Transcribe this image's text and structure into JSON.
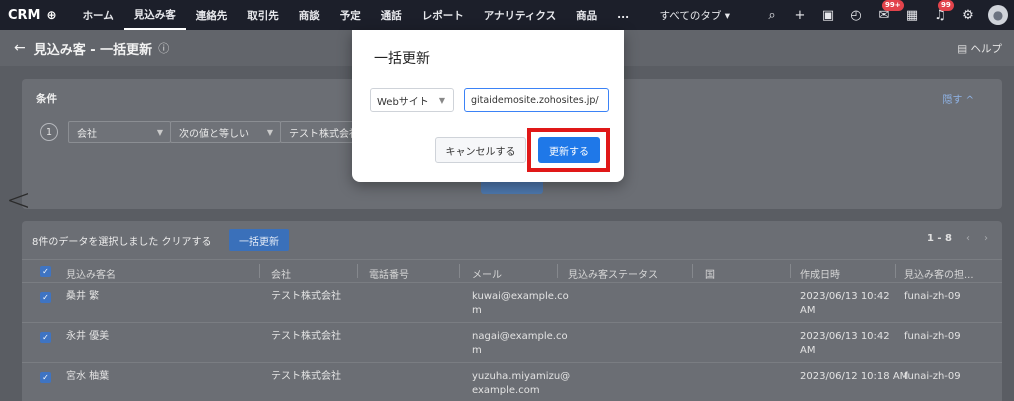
{
  "nav": {
    "brand": "CRM",
    "items": [
      "ホーム",
      "見込み客",
      "連絡先",
      "取引先",
      "商談",
      "予定",
      "通話",
      "レポート",
      "アナリティクス",
      "商品",
      "..."
    ],
    "active_index": 1,
    "all_tabs": "すべてのタブ ▾",
    "badge_mail": "99+",
    "badge_bell": "99"
  },
  "page": {
    "title": "見込み客 - 一括更新",
    "help": "ヘルプ"
  },
  "criteria": {
    "title": "条件",
    "hide": "隠す ^",
    "number": "1",
    "field": "会社",
    "operator": "次の値と等しい",
    "value": "テスト株式会社"
  },
  "list": {
    "selection_text": "8件のデータを選択しました クリアする",
    "bulk_button": "一括更新",
    "pager_range": "1 - 8",
    "columns": [
      "見込み客名",
      "会社",
      "電話番号",
      "メール",
      "見込み客ステータス",
      "国",
      "作成日時",
      "見込み客の担..."
    ],
    "rows": [
      {
        "name": "桑井 繁",
        "company": "テスト株式会社",
        "email1": "kuwai@example.co",
        "email2": "m",
        "created1": "2023/06/13 10:42",
        "created2": "AM",
        "owner": "funai-zh-09"
      },
      {
        "name": "永井 優美",
        "company": "テスト株式会社",
        "email1": "nagai@example.co",
        "email2": "m",
        "created1": "2023/06/13 10:42",
        "created2": "AM",
        "owner": "funai-zh-09"
      },
      {
        "name": "宮水 柚葉",
        "company": "テスト株式会社",
        "email1": "yuzuha.miyamizu@",
        "email2": "example.com",
        "created1": "2023/06/12 10:18 AM",
        "created2": "",
        "owner": "funai-zh-09"
      }
    ]
  },
  "dialog": {
    "title": "一括更新",
    "field_select": "Webサイト",
    "input_value": "gitaidemosite.zohosites.jp/",
    "cancel": "キャンセルする",
    "update": "更新する"
  }
}
